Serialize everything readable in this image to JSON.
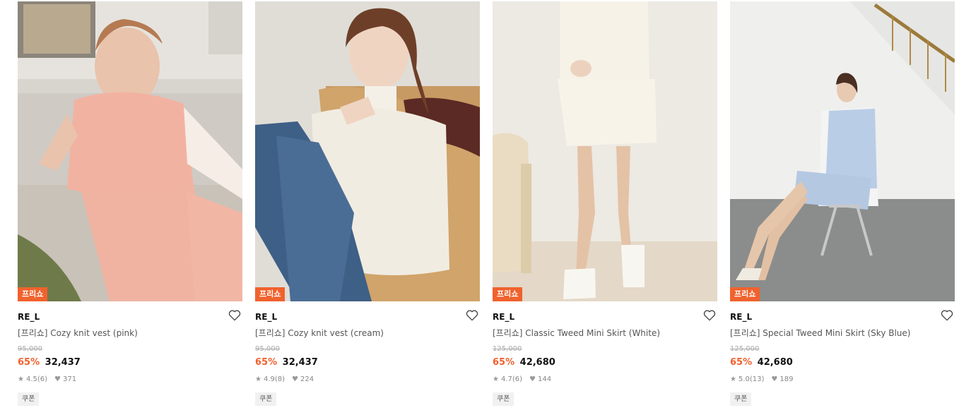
{
  "products": [
    {
      "badge": "프리쇼",
      "brand": "RE_L",
      "name": "[프리쇼] Cozy knit vest (pink)",
      "original_price": "95,000",
      "discount": "65%",
      "price": "32,437",
      "rating": "4.5",
      "reviews": "(6)",
      "likes": "371",
      "coupon": "쿠폰"
    },
    {
      "badge": "프리쇼",
      "brand": "RE_L",
      "name": "[프리쇼] Cozy knit vest (cream)",
      "original_price": "95,000",
      "discount": "65%",
      "price": "32,437",
      "rating": "4.9",
      "reviews": "(8)",
      "likes": "224",
      "coupon": "쿠폰"
    },
    {
      "badge": "프리쇼",
      "brand": "RE_L",
      "name": "[프리쇼] Classic Tweed Mini Skirt (White)",
      "original_price": "125,000",
      "discount": "65%",
      "price": "42,680",
      "rating": "4.7",
      "reviews": "(6)",
      "likes": "144",
      "coupon": "쿠폰"
    },
    {
      "badge": "프리쇼",
      "brand": "RE_L",
      "name": "[프리쇼] Special Tweed Mini Skirt (Sky Blue)",
      "original_price": "125,000",
      "discount": "65%",
      "price": "42,680",
      "rating": "5.0",
      "reviews": "(13)",
      "likes": "189",
      "coupon": "쿠폰"
    }
  ],
  "icons": {
    "wishlist": "heart-outline-icon",
    "rating": "star-icon",
    "likes": "heart-filled-icon"
  },
  "colors": {
    "accent": "#f0622d",
    "text": "#111111",
    "muted": "#888888"
  }
}
